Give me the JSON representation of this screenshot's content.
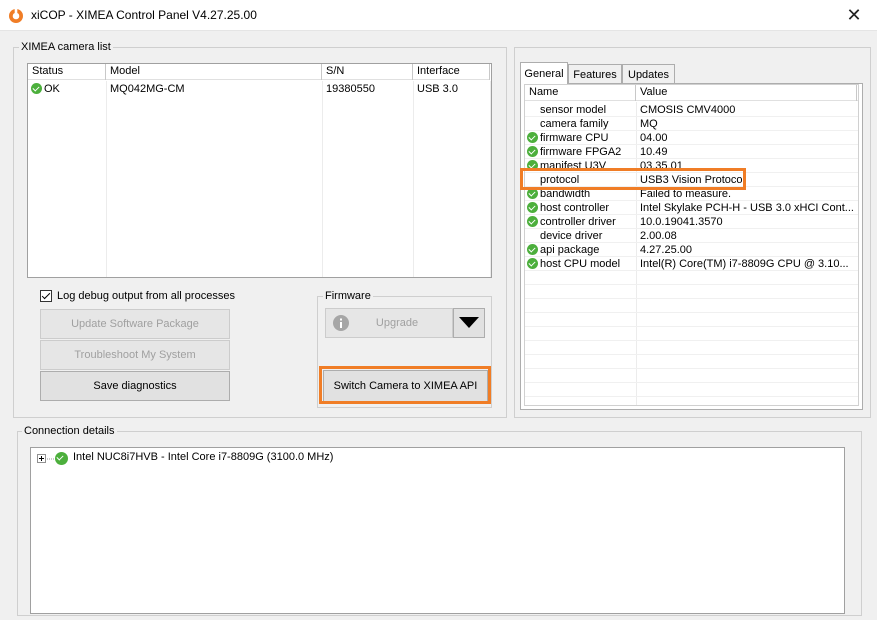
{
  "window": {
    "title": "xiCOP - XIMEA Control Panel V4.27.25.00",
    "close_symbol": "✕"
  },
  "camera_list": {
    "group_label": "XIMEA camera list",
    "columns": [
      "Status",
      "Model",
      "S/N",
      "Interface"
    ],
    "rows": [
      {
        "status_icon": "ok-check-icon",
        "status": "OK",
        "model": "MQ042MG-CM",
        "sn": "19380550",
        "interface": "USB 3.0"
      }
    ]
  },
  "options": {
    "log_debug_label": "Log debug output from all processes",
    "log_debug_checked": true,
    "update_software_label": "Update Software Package",
    "troubleshoot_label": "Troubleshoot My System",
    "save_diagnostics_label": "Save diagnostics"
  },
  "firmware": {
    "group_label": "Firmware",
    "upgrade_label": "Upgrade",
    "switch_label": "Switch Camera to XIMEA API"
  },
  "tabs": {
    "items": [
      "General",
      "Features",
      "Updates"
    ],
    "active": "General"
  },
  "properties": {
    "columns": [
      "Name",
      "Value"
    ],
    "rows": [
      {
        "ok": false,
        "name": "sensor model",
        "value": "CMOSIS CMV4000"
      },
      {
        "ok": false,
        "name": "camera family",
        "value": "MQ"
      },
      {
        "ok": true,
        "name": "firmware CPU",
        "value": "04.00"
      },
      {
        "ok": true,
        "name": "firmware FPGA2",
        "value": "10.49"
      },
      {
        "ok": true,
        "name": "manifest U3V",
        "value": "03.35.01"
      },
      {
        "ok": false,
        "name": "protocol",
        "value": "USB3 Vision Protocol"
      },
      {
        "ok": true,
        "name": "bandwidth",
        "value": "Failed to measure."
      },
      {
        "ok": true,
        "name": "host controller",
        "value": "Intel Skylake PCH-H - USB 3.0 xHCI Cont..."
      },
      {
        "ok": true,
        "name": "controller driver",
        "value": "10.0.19041.3570"
      },
      {
        "ok": false,
        "name": "device driver",
        "value": "2.00.08"
      },
      {
        "ok": true,
        "name": "api package",
        "value": "4.27.25.00"
      },
      {
        "ok": true,
        "name": "host CPU model",
        "value": "Intel(R) Core(TM) i7-8809G CPU @ 3.10..."
      }
    ]
  },
  "connection": {
    "group_label": "Connection details",
    "node_label": "Intel NUC8i7HVB - Intel Core i7-8809G (3100.0 MHz)"
  },
  "colors": {
    "highlight": "#f07d26",
    "ok_green": "#4caf3c"
  }
}
